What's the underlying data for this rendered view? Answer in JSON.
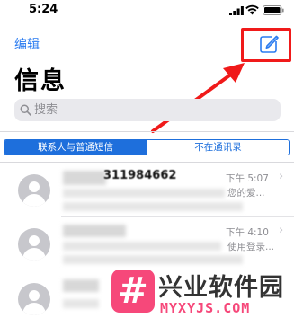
{
  "status_bar": {
    "time": "5:24"
  },
  "nav": {
    "edit_label": "编辑",
    "title": "信息"
  },
  "search": {
    "placeholder": "搜索"
  },
  "segments": [
    {
      "label": "联系人与普通短信",
      "selected": true
    },
    {
      "label": "不在通讯录",
      "selected": false
    }
  ],
  "messages": [
    {
      "sender_partial": "311984662",
      "time": "下午 5:07",
      "preview_fragment": "您的爱..."
    },
    {
      "sender_partial": "",
      "time": "下午 4:10",
      "preview_fragment": "使用登录..."
    },
    {
      "sender_partial": "",
      "time": "",
      "preview_fragment": ""
    }
  ],
  "watermark": {
    "text": "兴业软件园",
    "domain": "MYXYJS.COM"
  },
  "colors": {
    "accent": "#1e6fdc",
    "highlight": "#f01a1a",
    "watermark": "#f6487a"
  },
  "icons": [
    "signal-icon",
    "wifi-icon",
    "battery-icon",
    "compose-icon",
    "search-icon",
    "chevron-right-icon",
    "avatar-icon"
  ]
}
